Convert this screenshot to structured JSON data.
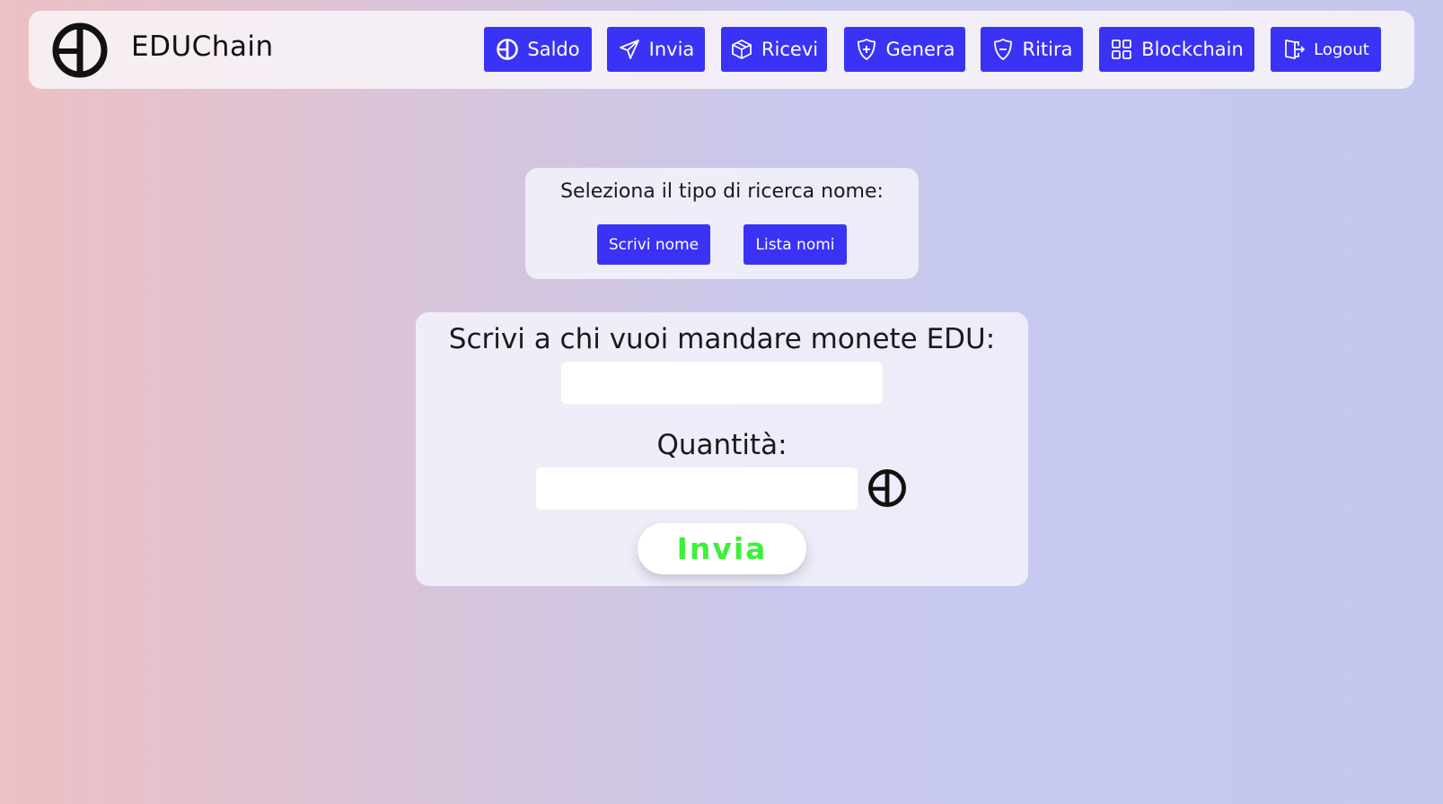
{
  "app": {
    "name": "EDUChain",
    "logo_icon": "edu-coin-logo-icon"
  },
  "nav": {
    "items": [
      {
        "label": "Saldo",
        "icon": "coin-icon"
      },
      {
        "label": "Invia",
        "icon": "paper-plane-icon"
      },
      {
        "label": "Ricevi",
        "icon": "box-icon"
      },
      {
        "label": "Genera",
        "icon": "shield-plus-icon"
      },
      {
        "label": "Ritira",
        "icon": "shield-minus-icon"
      },
      {
        "label": "Blockchain",
        "icon": "grid-icon"
      },
      {
        "label": "Logout",
        "icon": "door-exit-icon"
      }
    ]
  },
  "search_type": {
    "prompt": "Seleziona il tipo di ricerca nome:",
    "write_name_label": "Scrivi nome",
    "name_list_label": "Lista nomi"
  },
  "send_form": {
    "recipient_label": "Scrivi a chi vuoi mandare monete EDU:",
    "recipient_value": "",
    "quantity_label": "Quantità:",
    "quantity_value": "",
    "currency_icon": "edu-coin-icon",
    "submit_label": "Invia"
  },
  "colors": {
    "primary_button": "#3a32f5",
    "submit_text": "#3df03a",
    "panel_background": "#f0f0fa",
    "background_left": "#ecc0c4",
    "background_right": "#c4c8ef"
  }
}
